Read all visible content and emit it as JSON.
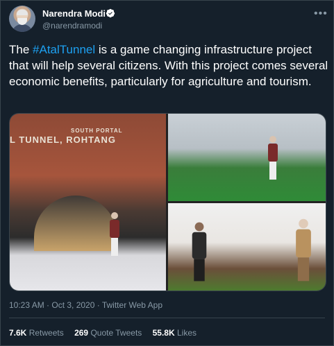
{
  "author": {
    "name": "Narendra Modi",
    "handle": "@narendramodi"
  },
  "tweet": {
    "text_before": "The ",
    "hashtag": "#AtalTunnel",
    "text_after": " is a game changing infrastructure project that will help several citizens. With this project comes several economic benefits, particularly for agriculture and tourism."
  },
  "media": {
    "sign_top": "SOUTH PORTAL",
    "sign_main": "L TUNNEL, ROHTANG"
  },
  "meta": {
    "timestamp": "10:23 AM · Oct 3, 2020 · Twitter Web App"
  },
  "stats": {
    "retweets_count": "7.6K",
    "retweets_label": "Retweets",
    "quotes_count": "269",
    "quotes_label": "Quote Tweets",
    "likes_count": "55.8K",
    "likes_label": "Likes"
  },
  "colors": {
    "background": "#15202b",
    "accent": "#1da1f2",
    "muted": "#8899a6",
    "border": "#38444d"
  }
}
